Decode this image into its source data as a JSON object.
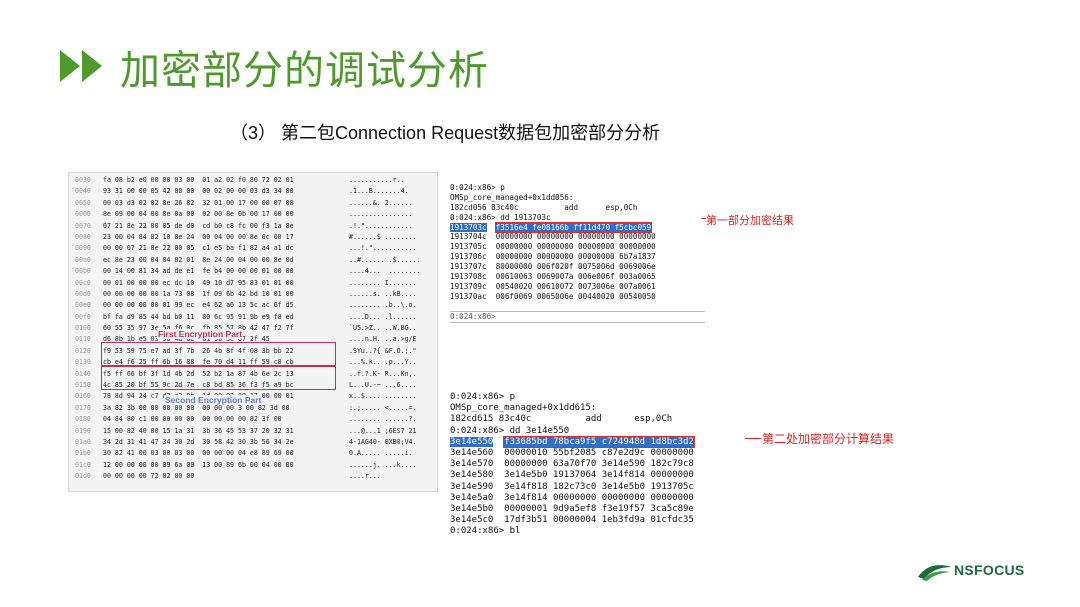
{
  "slide": {
    "title": "加密部分的调试分析",
    "subtitle": "（3）  第二包Connection Request数据包加密部分分析",
    "accent_color": "#4e9a2d",
    "title_icon": "double-chevron-right-icon"
  },
  "hexdump": {
    "rows": [
      {
        "off": "0030",
        "bytes": "fa 08 b2 e0 00 00 03 00  01 a2 02 f0 80 72 02 01",
        "ascii": "...........r.."
      },
      {
        "off": "0040",
        "bytes": "93 31 00 00 05 42 00 00  00 02 00 00 03 d3 34 00",
        "ascii": ".1...B.......4."
      },
      {
        "off": "0050",
        "bytes": "00 03 d3 02 02 8e 26 82  32 01 00 17 00 00 07 08",
        "ascii": "......&. 2......"
      },
      {
        "off": "0060",
        "bytes": "8e 09 00 04 00 8e 0a 00  02 00 8e 0b 00 17 00 00",
        "ascii": "................"
      },
      {
        "off": "0070",
        "bytes": "07 21 8e 22 00 05 de d0  cd b0 c8 fc 00 f3 1a 8e",
        "ascii": ".!.\"............"
      },
      {
        "off": "0080",
        "bytes": "23 00 04 84 82 10 8e 24  00 04 00 00 8e 0c 00 17",
        "ascii": "#......$ ........"
      },
      {
        "off": "0090",
        "bytes": "00 00 07 21 8e 22 00 05  c1 e5 ba f1 82 a4 a1 dc",
        "ascii": "...!.\"..........."
      },
      {
        "off": "00a0",
        "bytes": "ec 8e 23 00 04 84 82 01  8e 24 00 04 00 00 8e 0d",
        "ascii": "..#...... .$......"
      },
      {
        "off": "00b0",
        "bytes": "00 14 00 81 34 ad de e1  fe b4 00 00 00 01 00 00",
        "ascii": "....4...  ........"
      },
      {
        "off": "00c0",
        "bytes": "00 01 00 00 00 ec dc 10  49 10 d7 95 83 01 01 00",
        "ascii": "........ I......."
      },
      {
        "off": "00d0",
        "bytes": "00 00 00 00 00 1a 73 08  1f 09 6b 42 bd 10 01 00",
        "ascii": "......s. ..kB...."
      },
      {
        "off": "00e0",
        "bytes": "00 00 00 00 00 01 99 ec  e4 62 a6 13 5c ac 6f d5",
        "ascii": "........ .b..\\.o."
      },
      {
        "off": "00f0",
        "bytes": "bf fa d9 85 44 bd b0 11  80 6c 95 91 9b e9 f8 ed",
        "ascii": "....D... .l......"
      },
      {
        "off": "0100",
        "bytes": "60 55 35 97 3e 5a f6 0c  fb 85 57 8b 42 47 f2 7f",
        "ascii": "`U5.>Z.. ..W.BG.."
      },
      {
        "off": "0110",
        "bytes": "d6 8b 1b e5 03 50 4a 8e  61 9b 3e 67 2f 45",
        "ascii": "....n.H. ..a.>g/E"
      },
      {
        "off": "0120",
        "bytes": "f9 53 59 75 e7 ad 3f 7b  26 4b 8f 4f 08 3b bb 22",
        "ascii": ".SYu..?{ &F.O.;.\""
      },
      {
        "off": "0130",
        "bytes": "cb e4 f6 25 ff 6b 16 88  fe 70 d4 11 ff 59 c0 cb",
        "ascii": "...%.k.. .p...Y.."
      },
      {
        "off": "0140",
        "bytes": "f5 ff 66 bf 3f 1d 4b 2d  52 b2 1a 87 4b 6e 2c 13",
        "ascii": "..f.?.K- R...Kn,."
      },
      {
        "off": "0150",
        "bytes": "4c 85 20 bf 55 9c 2d 7e  c8 bd 85 36 f3 f5 a9 bc",
        "ascii": "L. .U.-~ ...6...."
      },
      {
        "off": "0160",
        "bytes": "78 8d 94 24 c7 d2 c3 8b  1d 00 02 00 17 00 00 01",
        "ascii": "x..$.... ........"
      },
      {
        "off": "0170",
        "bytes": "3a 82 3b 00 00 00 00 00  00 00 00 3 00 82 3d 00",
        "ascii": ":.;..... <.....=."
      },
      {
        "off": "0180",
        "bytes": "04 84 80 c1 00 00 00 00  00 00 00 00 82 3f 00",
        "ascii": "........ ......?."
      },
      {
        "off": "0190",
        "bytes": "15 00 82 40 00 15 1a 31  3b 36 45 53 37 20 32 31",
        "ascii": "...@...1 ;6ES7 21"
      },
      {
        "off": "01a0",
        "bytes": "34 2d 31 41 47 34 30 2d  30 58 42 30 3b 56 34 2e",
        "ascii": "4-1AG40- 0XB0;V4."
      },
      {
        "off": "01b0",
        "bytes": "30 82 41 00 03 00 03 00  00 00 00 04 e8 89 69 00",
        "ascii": "0.A..... .....i."
      },
      {
        "off": "01c0",
        "bytes": "12 00 00 00 00 89 6a 00  13 00 89 6b 00 04 00 00",
        "ascii": "......j. ...k...."
      },
      {
        "off": "01d0",
        "bytes": "00 00 00 00 72 02 00 00",
        "ascii": "....r..."
      }
    ],
    "first_label": "First Encryption Part",
    "second_label": "Second Encryption Part",
    "box_color": "#cc2a5a"
  },
  "debugger1": {
    "lines": [
      "0:024:x86> p",
      "OMSp_core_managed+0x1dd056:",
      "182cd056 83c40c          add      esp,0Ch",
      "0:024:x86> dd 1913703c",
      "1913703c  f3516e4 fe08166b ff11d470 f5cbc059",
      "1913704c  00000000 00000000 00000000 00000000",
      "1913705c  00000000 00000000 00000000 00000000",
      "1913706c  00000000 00000000 00000000 6b7a1837",
      "1913707c  80000000 006f020f 0075006d 0069006e",
      "1913708c  00610063 0069007a 006e006f 003a0065",
      "1913709c  00540020 00610072 0073006e 007a0061",
      "191370ac  006f0069 0065006e 00440020 00540050"
    ],
    "highlight_index": 4,
    "prompt": "0:024:x86>",
    "annotation": "第一部分加密结果"
  },
  "debugger2": {
    "lines": [
      "0:024:x86> p",
      "OMSp_core_managed+0x1dd615:",
      "182cd615 83c40c          add      esp,0Ch",
      "0:024:x86> dd 3e14e550",
      "3e14e550  f33685bd 78bca9f5 c724948d 1d8bc3d2",
      "3e14e560  00000010 55bf2085 c87e2d9c 00000000",
      "3e14e570  00000000 63a70f70 3e14e590 182c79c8",
      "3e14e580  3e14e5b0 19137064 3e14f814 00000000",
      "3e14e590  3e14f818 182c73c0 3e14e5b0 1913705c",
      "3e14e5a0  3e14f814 00000000 00000000 00000000",
      "3e14e5b0  00000001 9d9a5ef8 f3e19f57 3ca5c89e",
      "3e14e5c0  17df3b51 00000004 1eb3fd9a 01cfdc35",
      "0:024:x86> bl"
    ],
    "highlight_index": 4,
    "annotation": "第二处加密部分计算结果"
  },
  "logo": {
    "text": "NSFOCUS",
    "color": "#1e6b3a"
  }
}
